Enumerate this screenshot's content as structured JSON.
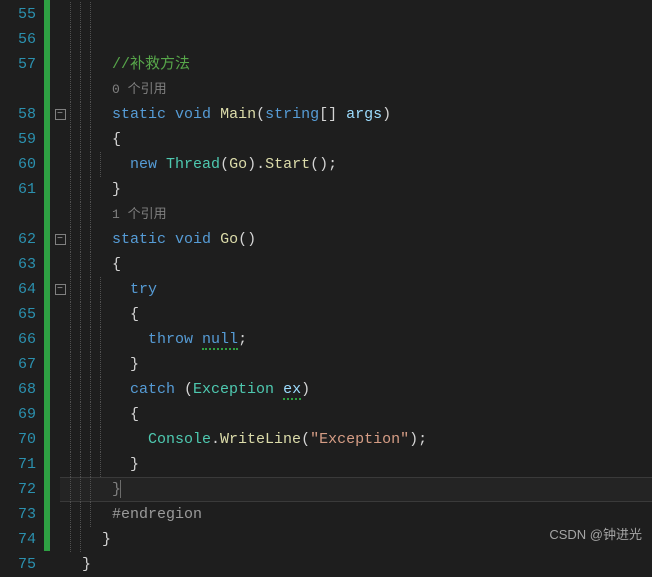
{
  "lineNumbers": {
    "start": 55,
    "end": 75
  },
  "foldMarkers": {
    "rows": [
      3,
      7,
      9
    ]
  },
  "indentGuides": {
    "x": [
      0,
      10,
      20,
      30
    ]
  },
  "code": {
    "l55": {},
    "l56": {},
    "l57": {
      "comment": "//补救方法"
    },
    "l57ref": {
      "ref": "0 个引用"
    },
    "l58": {
      "kw1": "static",
      "kw2": "void",
      "method": "Main",
      "p1": "(",
      "type": "string",
      "arr": "[] ",
      "param": "args",
      "p2": ")"
    },
    "l59": {
      "brace": "{"
    },
    "l60": {
      "kw": "new",
      "type": "Thread",
      "p1": "(",
      "method": "Go",
      "p2": ").",
      "method2": "Start",
      "p3": "();"
    },
    "l61": {
      "brace": "}"
    },
    "l61ref": {
      "ref": "1 个引用"
    },
    "l62": {
      "kw1": "static",
      "kw2": "void",
      "method": "Go",
      "p": "()"
    },
    "l63": {
      "brace": "{"
    },
    "l64": {
      "kw": "try"
    },
    "l65": {
      "brace": "{"
    },
    "l66": {
      "kw": "throw",
      "val": "null",
      "semi": ";"
    },
    "l67": {
      "brace": "}"
    },
    "l68": {
      "kw": "catch",
      "p1": " (",
      "type": "Exception",
      "param": "ex",
      "p2": ")"
    },
    "l69": {
      "brace": "{"
    },
    "l70": {
      "cls": "Console",
      "dot": ".",
      "method": "WriteLine",
      "p1": "(",
      "str": "\"Exception\"",
      "p2": ");"
    },
    "l71": {
      "brace": "}"
    },
    "l72": {
      "brace": "}"
    },
    "l73": {
      "region": "#endregion"
    },
    "l74": {
      "brace": "}"
    },
    "l75": {
      "brace": "}"
    }
  },
  "watermark": "CSDN @钟进光"
}
